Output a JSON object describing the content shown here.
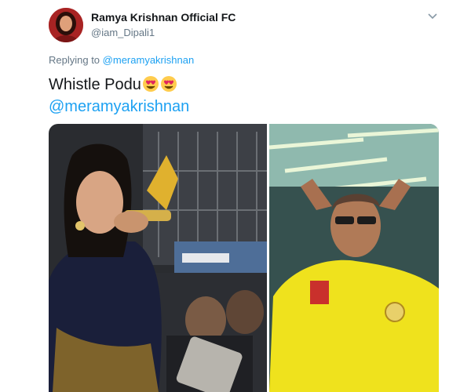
{
  "tweet": {
    "display_name": "Ramya Krishnan Official FC",
    "handle": "@iam_Dipali1",
    "reply_prefix": "Replying to",
    "reply_to": "@meramyakrishnan",
    "text": "Whistle Podu",
    "emojis": [
      "heart-eyes",
      "heart-eyes"
    ],
    "mention": "@meramyakrishnan"
  },
  "colors": {
    "link": "#1da1f2",
    "name": "#14171a",
    "meta": "#657786",
    "jersey": "#f2e21c"
  }
}
